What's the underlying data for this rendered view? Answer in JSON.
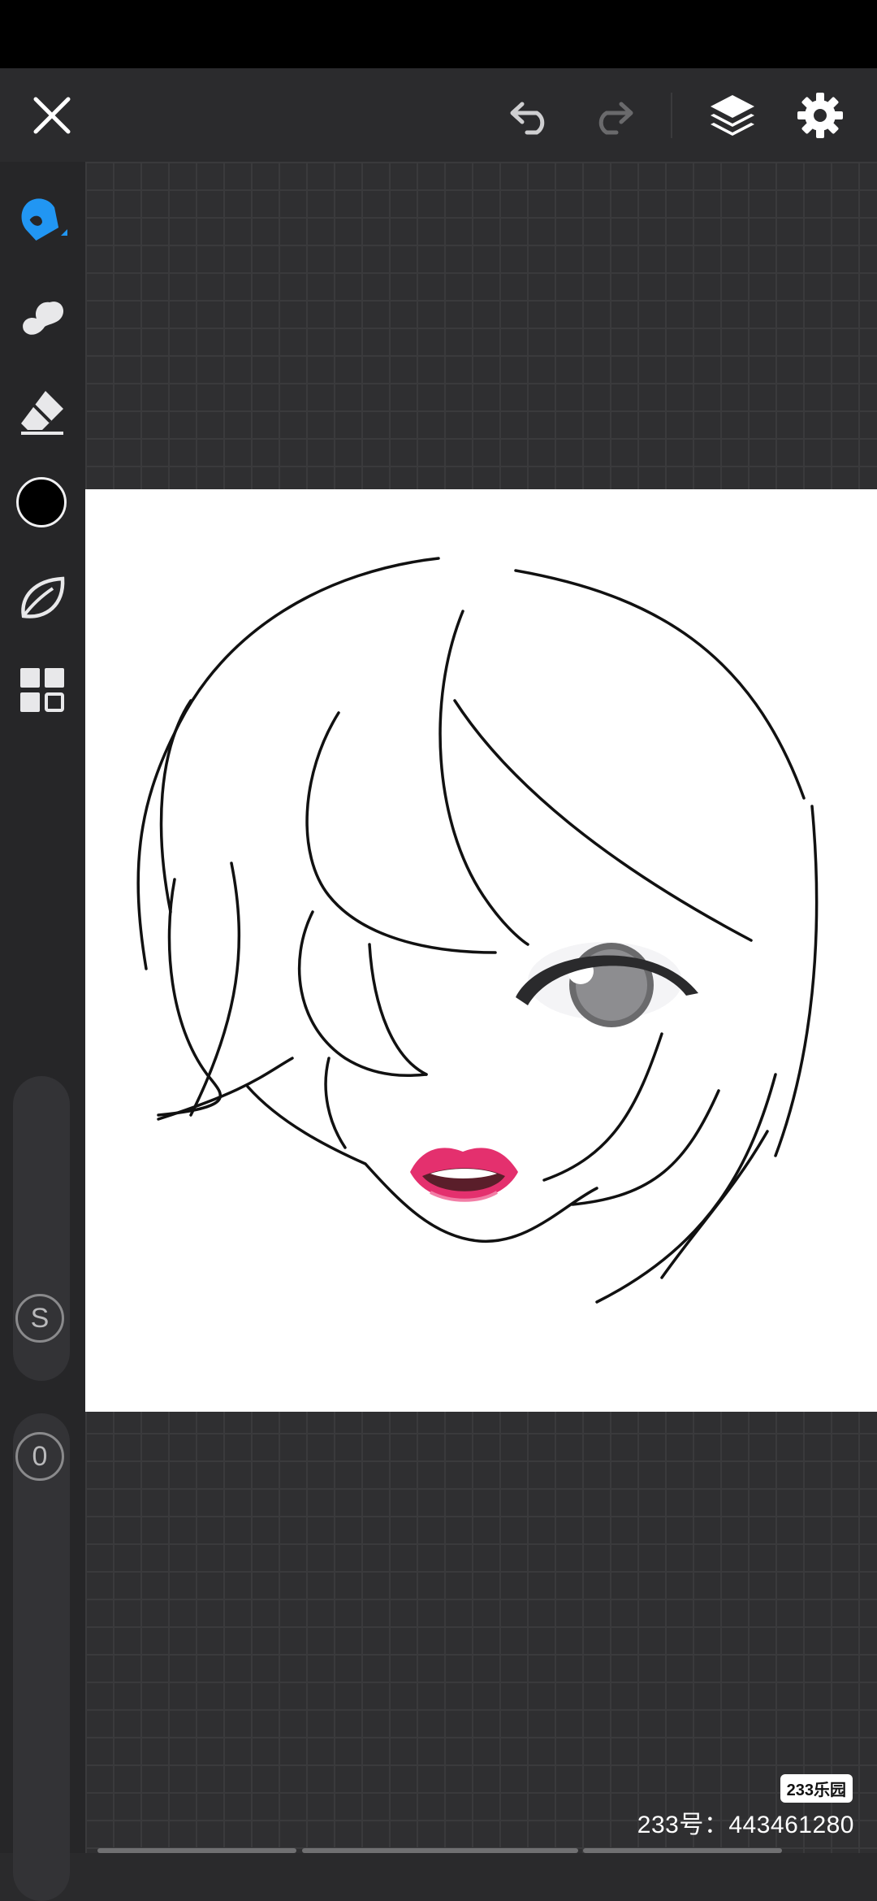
{
  "toolbar": {
    "close": "close",
    "undo": "undo",
    "redo": "redo",
    "layers": "layers",
    "settings": "settings"
  },
  "sidebar": {
    "tools": [
      "pen",
      "smudge",
      "eraser",
      "color",
      "stabilizer",
      "gallery"
    ],
    "current_color": "#000000",
    "accent_color": "#2196f3",
    "size_slider_label": "S",
    "opacity_slider_label": "0"
  },
  "watermark": {
    "logo": "233乐园",
    "id_text": "233号：443461280"
  }
}
